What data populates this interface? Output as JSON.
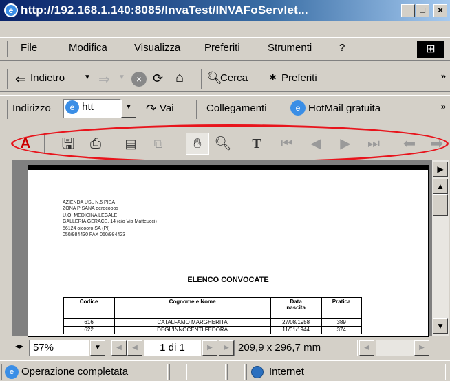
{
  "window": {
    "title": "http://192.168.1.140:8085/InvaTest/INVAFoServlet...",
    "controls": [
      "_",
      "□",
      "X"
    ]
  },
  "menu": {
    "items": [
      "File",
      "Modifica",
      "Visualizza",
      "Preferiti",
      "Strumenti",
      "?"
    ]
  },
  "toolbar": {
    "back": "Indietro",
    "search": "Cerca",
    "favorites": "Preferiti",
    "overflow": "»"
  },
  "address": {
    "label": "Indirizzo",
    "value": "htt",
    "go": "Vai",
    "links_label": "Collegamenti",
    "hotmail": "HotMail gratuita",
    "overflow": "»"
  },
  "acrobat_toolbar": {
    "icons": [
      "acrobat-logo",
      "save-icon",
      "print-icon",
      "bookmarks-icon",
      "copy-icon",
      "hand-tool-icon",
      "zoom-icon",
      "text-select-icon",
      "first-page-icon",
      "prev-page-icon",
      "next-page-icon",
      "last-page-icon",
      "go-back-icon",
      "go-forward-icon"
    ],
    "highlight_color": "#e8141c"
  },
  "document": {
    "address_block": "AZIENDA USL N.5 PISA\nZONA PISANA oerocooos\nU.O. MEDICINA LEGALE\nGALLERIA GERACE. 14 (c/o Via Matteucci)\n56124 oicooroISA (PI)\n050/984430 FAX 050/984423",
    "heading": "ELENCO CONVOCATE",
    "table": {
      "headers": [
        "Codice",
        "Cognome e Nome",
        "Data\nnascita",
        "Pratica"
      ],
      "rows": [
        [
          "616",
          "CATALFAMO MARGHERITA",
          "27/08/1958",
          "389"
        ],
        [
          "622",
          "DEGL'INNOCENTI FEDORA",
          "11/01/1944",
          "374"
        ]
      ]
    }
  },
  "nav": {
    "zoom": "57%",
    "page": "1 di 1",
    "size": "209,9 x 296,7 mm"
  },
  "status": {
    "message": "Operazione completata",
    "zone": "Internet"
  }
}
